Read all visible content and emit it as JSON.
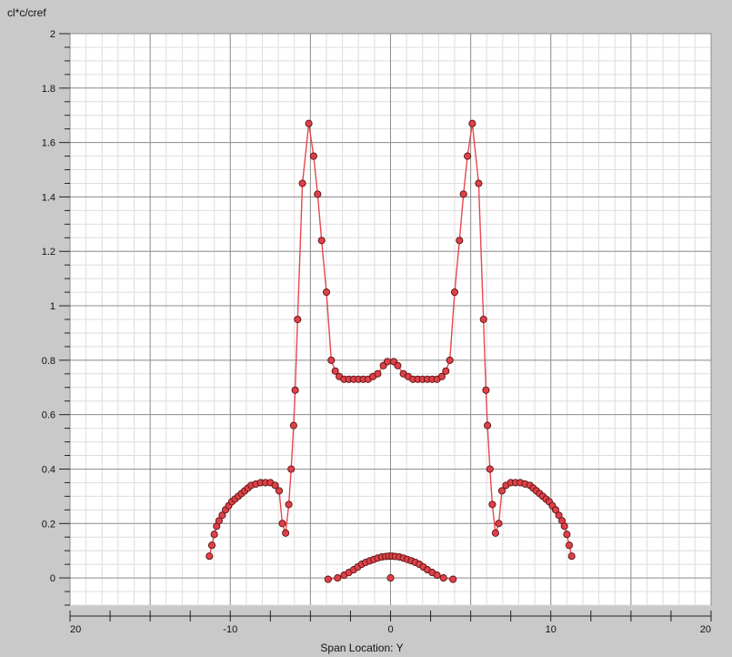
{
  "chart_data": {
    "type": "line",
    "title": "",
    "ylabel": "cl*c/cref",
    "xlabel": "Span Location: Y",
    "xlim": [
      -20,
      20
    ],
    "ylim": [
      -0.1,
      2.0
    ],
    "x_ticks": [
      {
        "value": -20,
        "label": "20"
      },
      {
        "value": -10,
        "label": "-10"
      },
      {
        "value": 0,
        "label": "0"
      },
      {
        "value": 10,
        "label": "10"
      },
      {
        "value": 20,
        "label": "20"
      }
    ],
    "y_ticks": [
      {
        "value": 2,
        "label": "2"
      },
      {
        "value": 1.8,
        "label": "1.8"
      },
      {
        "value": 1.6,
        "label": "1.6"
      },
      {
        "value": 1.4,
        "label": "1.4"
      },
      {
        "value": 1.2,
        "label": "1.2"
      },
      {
        "value": 1,
        "label": "1"
      },
      {
        "value": 0.8,
        "label": "0.8"
      },
      {
        "value": 0.6,
        "label": "0.6"
      },
      {
        "value": 0.4,
        "label": "0.4"
      },
      {
        "value": 0.2,
        "label": "0.2"
      },
      {
        "value": 0,
        "label": "0"
      }
    ],
    "grid": true,
    "legend": "none",
    "colors": {
      "line": "#e8474d",
      "marker_fill": "#e04048",
      "marker_stroke": "#5a1414",
      "background": "#ffffff",
      "grid_major": "#8f8f8f",
      "grid_minor": "#dedede"
    },
    "series": [
      {
        "points": [
          [
            -11.3,
            0.08
          ],
          [
            -11.15,
            0.12
          ],
          [
            -11.0,
            0.16
          ],
          [
            -10.85,
            0.19
          ],
          [
            -10.7,
            0.21
          ],
          [
            -10.5,
            0.23
          ],
          [
            -10.3,
            0.25
          ],
          [
            -10.1,
            0.265
          ],
          [
            -9.9,
            0.28
          ],
          [
            -9.7,
            0.29
          ],
          [
            -9.5,
            0.3
          ],
          [
            -9.3,
            0.31
          ],
          [
            -9.1,
            0.32
          ],
          [
            -8.9,
            0.33
          ],
          [
            -8.7,
            0.34
          ],
          [
            -8.4,
            0.345
          ],
          [
            -8.1,
            0.35
          ],
          [
            -7.8,
            0.35
          ],
          [
            -7.5,
            0.35
          ],
          [
            -7.2,
            0.34
          ],
          [
            -6.95,
            0.32
          ],
          [
            -6.75,
            0.2
          ],
          [
            -6.55,
            0.165
          ],
          [
            -6.35,
            0.27
          ],
          [
            -6.2,
            0.4
          ],
          [
            -6.05,
            0.56
          ],
          [
            -5.95,
            0.69
          ],
          [
            -5.8,
            0.95
          ],
          [
            -5.5,
            1.45
          ],
          [
            -5.1,
            1.67
          ],
          [
            -4.8,
            1.55
          ],
          [
            -4.55,
            1.41
          ],
          [
            -4.3,
            1.24
          ],
          [
            -4.0,
            1.05
          ],
          [
            -3.7,
            0.8
          ],
          [
            -3.45,
            0.76
          ],
          [
            -3.2,
            0.74
          ],
          [
            -2.9,
            0.73
          ],
          [
            -2.6,
            0.73
          ],
          [
            -2.3,
            0.73
          ],
          [
            -2.0,
            0.73
          ],
          [
            -1.7,
            0.73
          ],
          [
            -1.4,
            0.73
          ],
          [
            -1.1,
            0.74
          ],
          [
            -0.8,
            0.75
          ],
          [
            -0.45,
            0.78
          ],
          [
            -0.2,
            0.795
          ],
          [
            0.2,
            0.795
          ],
          [
            0.45,
            0.78
          ],
          [
            0.8,
            0.75
          ],
          [
            1.1,
            0.74
          ],
          [
            1.4,
            0.73
          ],
          [
            1.7,
            0.73
          ],
          [
            2.0,
            0.73
          ],
          [
            2.3,
            0.73
          ],
          [
            2.6,
            0.73
          ],
          [
            2.9,
            0.73
          ],
          [
            3.2,
            0.74
          ],
          [
            3.45,
            0.76
          ],
          [
            3.7,
            0.8
          ],
          [
            4.0,
            1.05
          ],
          [
            4.3,
            1.24
          ],
          [
            4.55,
            1.41
          ],
          [
            4.8,
            1.55
          ],
          [
            5.1,
            1.67
          ],
          [
            5.5,
            1.45
          ],
          [
            5.8,
            0.95
          ],
          [
            5.95,
            0.69
          ],
          [
            6.05,
            0.56
          ],
          [
            6.2,
            0.4
          ],
          [
            6.35,
            0.27
          ],
          [
            6.55,
            0.165
          ],
          [
            6.75,
            0.2
          ],
          [
            6.95,
            0.32
          ],
          [
            7.2,
            0.34
          ],
          [
            7.5,
            0.35
          ],
          [
            7.8,
            0.35
          ],
          [
            8.1,
            0.35
          ],
          [
            8.4,
            0.345
          ],
          [
            8.7,
            0.34
          ],
          [
            8.9,
            0.33
          ],
          [
            9.1,
            0.32
          ],
          [
            9.3,
            0.31
          ],
          [
            9.5,
            0.3
          ],
          [
            9.7,
            0.29
          ],
          [
            9.9,
            0.28
          ],
          [
            10.1,
            0.265
          ],
          [
            10.3,
            0.25
          ],
          [
            10.5,
            0.23
          ],
          [
            10.7,
            0.21
          ],
          [
            10.85,
            0.19
          ],
          [
            11.0,
            0.16
          ],
          [
            11.15,
            0.12
          ],
          [
            11.3,
            0.08
          ]
        ]
      },
      {
        "points": [
          [
            -3.9,
            -0.005
          ],
          [
            -3.3,
            0.0
          ],
          [
            -2.9,
            0.01
          ],
          [
            -2.6,
            0.02
          ],
          [
            -2.3,
            0.03
          ],
          [
            -2.05,
            0.04
          ],
          [
            -1.8,
            0.05
          ],
          [
            -1.55,
            0.057
          ],
          [
            -1.3,
            0.063
          ],
          [
            -1.05,
            0.068
          ],
          [
            -0.8,
            0.073
          ],
          [
            -0.55,
            0.077
          ],
          [
            -0.3,
            0.079
          ],
          [
            -0.1,
            0.08
          ],
          [
            0.1,
            0.08
          ],
          [
            0.3,
            0.079
          ],
          [
            0.55,
            0.077
          ],
          [
            0.8,
            0.073
          ],
          [
            1.05,
            0.068
          ],
          [
            1.3,
            0.063
          ],
          [
            1.55,
            0.057
          ],
          [
            1.8,
            0.05
          ],
          [
            2.05,
            0.04
          ],
          [
            2.3,
            0.03
          ],
          [
            2.6,
            0.02
          ],
          [
            2.9,
            0.01
          ],
          [
            3.3,
            0.0
          ],
          [
            3.9,
            -0.005
          ]
        ]
      },
      {
        "points": [
          [
            0.0,
            0.0
          ]
        ]
      }
    ]
  }
}
